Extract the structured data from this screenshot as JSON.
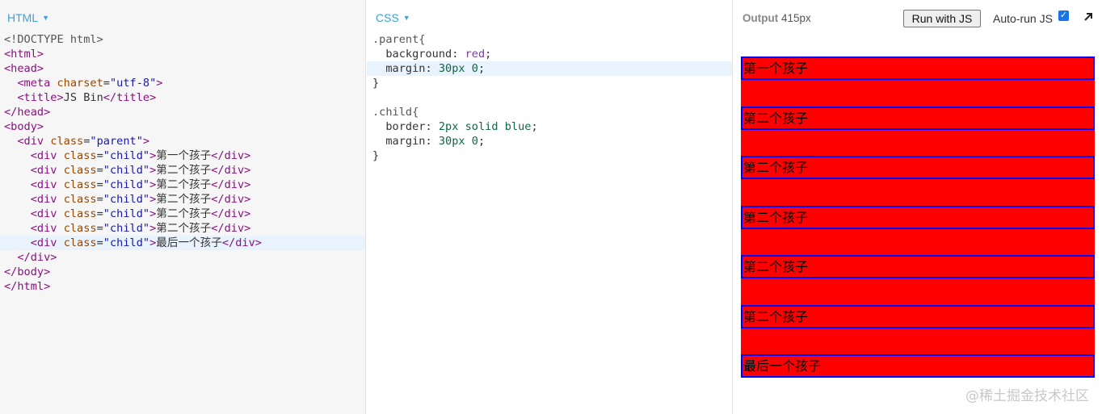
{
  "html_panel": {
    "label": "HTML",
    "lines": [
      {
        "doctype": "<!DOCTYPE html>"
      },
      {
        "o": "<",
        "tag": "html",
        "c": ">"
      },
      {
        "o": "<",
        "tag": "head",
        "c": ">"
      },
      {
        "indent": "  ",
        "o": "<",
        "tag": "meta",
        "attr": "charset",
        "eq": "=",
        "val": "\"utf-8\"",
        "c": ">"
      },
      {
        "indent": "  ",
        "o": "<",
        "tag": "title",
        "c": ">",
        "text": "JS Bin",
        "close_o": "</",
        "close_tag": "title",
        "close_c": ">"
      },
      {
        "o": "</",
        "tag": "head",
        "c": ">"
      },
      {
        "o": "<",
        "tag": "body",
        "c": ">"
      },
      {
        "indent": "  ",
        "o": "<",
        "tag": "div",
        "attr": "class",
        "eq": "=",
        "val": "\"parent\"",
        "c": ">"
      },
      {
        "indent": "    ",
        "o": "<",
        "tag": "div",
        "attr": "class",
        "eq": "=",
        "val": "\"child\"",
        "c": ">",
        "text": "第一个孩子",
        "close_o": "</",
        "close_tag": "div",
        "close_c": ">"
      },
      {
        "indent": "    ",
        "o": "<",
        "tag": "div",
        "attr": "class",
        "eq": "=",
        "val": "\"child\"",
        "c": ">",
        "text": "第二个孩子",
        "close_o": "</",
        "close_tag": "div",
        "close_c": ">"
      },
      {
        "indent": "    ",
        "o": "<",
        "tag": "div",
        "attr": "class",
        "eq": "=",
        "val": "\"child\"",
        "c": ">",
        "text": "第二个孩子",
        "close_o": "</",
        "close_tag": "div",
        "close_c": ">"
      },
      {
        "indent": "    ",
        "o": "<",
        "tag": "div",
        "attr": "class",
        "eq": "=",
        "val": "\"child\"",
        "c": ">",
        "text": "第二个孩子",
        "close_o": "</",
        "close_tag": "div",
        "close_c": ">"
      },
      {
        "indent": "    ",
        "o": "<",
        "tag": "div",
        "attr": "class",
        "eq": "=",
        "val": "\"child\"",
        "c": ">",
        "text": "第二个孩子",
        "close_o": "</",
        "close_tag": "div",
        "close_c": ">"
      },
      {
        "indent": "    ",
        "o": "<",
        "tag": "div",
        "attr": "class",
        "eq": "=",
        "val": "\"child\"",
        "c": ">",
        "text": "第二个孩子",
        "close_o": "</",
        "close_tag": "div",
        "close_c": ">"
      },
      {
        "indent": "    ",
        "o": "<",
        "tag": "div",
        "attr": "class",
        "eq": "=",
        "val": "\"child\"",
        "c": ">",
        "text": "最后一个孩子",
        "close_o": "</",
        "close_tag": "div",
        "close_c": ">",
        "highlight": true
      },
      {
        "indent": "  ",
        "o": "</",
        "tag": "div",
        "c": ">"
      },
      {
        "o": "</",
        "tag": "body",
        "c": ">"
      },
      {
        "o": "</",
        "tag": "html",
        "c": ">"
      }
    ]
  },
  "css_panel": {
    "label": "CSS",
    "lines": [
      {
        "selector": ".parent{"
      },
      {
        "indent": "  ",
        "prop": "background",
        "colon": ":",
        "val": "red",
        "semi": ";"
      },
      {
        "indent": "  ",
        "prop": "margin",
        "colon": ":",
        "num": "30px",
        "val": "0",
        "semi": ";",
        "highlight": true
      },
      {
        "brace": "}"
      },
      {
        "blank": true
      },
      {
        "selector": ".child{"
      },
      {
        "indent": "  ",
        "prop": "border",
        "colon": ":",
        "num": "2px",
        "val": "solid blue",
        "semi": ";"
      },
      {
        "indent": "  ",
        "prop": "margin",
        "colon": ":",
        "num": "30px",
        "val": "0",
        "semi": ";"
      },
      {
        "brace": "}"
      }
    ]
  },
  "output_panel": {
    "label": "Output",
    "width_text": "415px",
    "run_button": "Run with JS",
    "autorun_label": "Auto-run JS",
    "autorun_checked": true,
    "children": [
      "第一个孩子",
      "第二个孩子",
      "第二个孩子",
      "第二个孩子",
      "第二个孩子",
      "第二个孩子",
      "最后一个孩子"
    ]
  },
  "colors": {
    "panel_label": "#3ea0d8",
    "parent_bg": "#ff0000",
    "child_border": "#0000ff",
    "tag": "#881280",
    "attr": "#994500",
    "attr_value": "#1a1aa6"
  },
  "watermark": "@稀土掘金技术社区"
}
